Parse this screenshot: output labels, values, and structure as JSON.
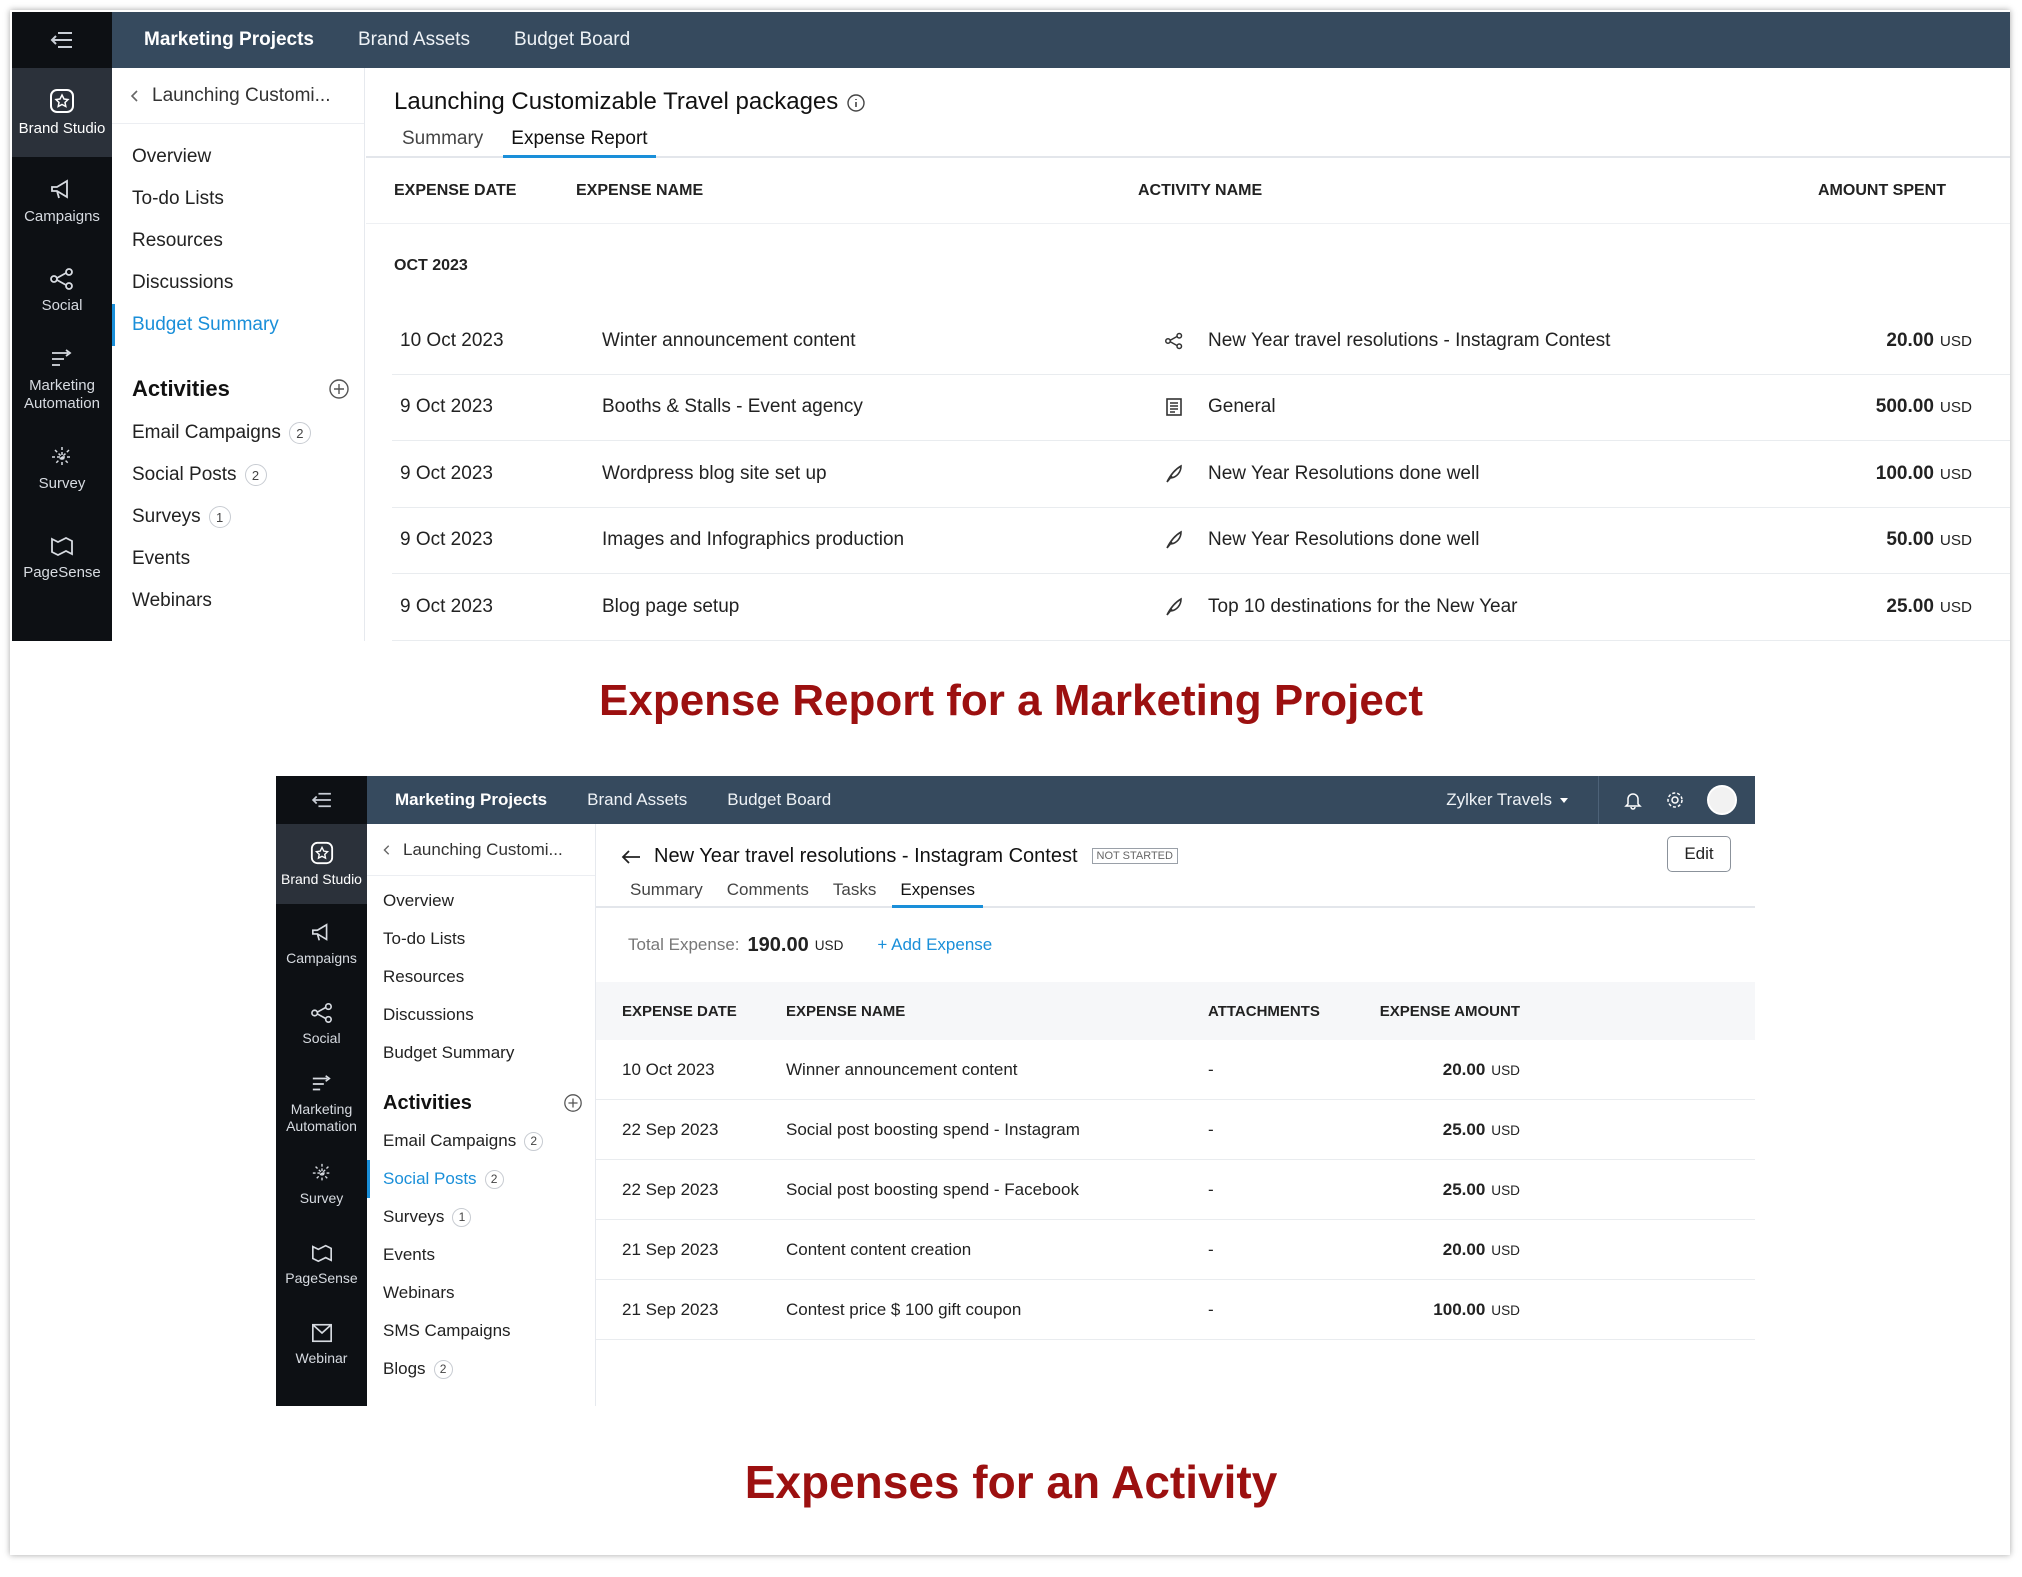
{
  "colors": {
    "rail": "#0d1014",
    "topbar": "#364a5e",
    "accent": "#1a8fd9",
    "caption": "#9c1010"
  },
  "rail": [
    {
      "label": "Brand Studio",
      "icon": "brand-studio-icon"
    },
    {
      "label": "Campaigns",
      "icon": "megaphone-icon"
    },
    {
      "label": "Social",
      "icon": "share-icon"
    },
    {
      "label": "Marketing Automation",
      "icon": "automation-icon"
    },
    {
      "label": "Survey",
      "icon": "survey-icon"
    },
    {
      "label": "PageSense",
      "icon": "pagesense-icon"
    },
    {
      "label": "Webinar",
      "icon": "webinar-icon"
    }
  ],
  "topnav": [
    "Marketing Projects",
    "Brand Assets",
    "Budget Board"
  ],
  "sidebar": {
    "breadcrumb": "Launching Customi...",
    "nav": [
      "Overview",
      "To-do Lists",
      "Resources",
      "Discussions",
      "Budget Summary"
    ],
    "activities_heading": "Activities",
    "activities": [
      {
        "label": "Email Campaigns",
        "count": "2"
      },
      {
        "label": "Social Posts",
        "count": "2"
      },
      {
        "label": "Surveys",
        "count": "1"
      },
      {
        "label": "Events",
        "count": ""
      },
      {
        "label": "Webinars",
        "count": ""
      },
      {
        "label": "SMS Campaigns",
        "count": ""
      },
      {
        "label": "Blogs",
        "count": "2"
      }
    ]
  },
  "report": {
    "title": "Launching Customizable Travel packages",
    "tabs": [
      "Summary",
      "Expense Report"
    ],
    "columns": [
      "EXPENSE DATE",
      "EXPENSE NAME",
      "ACTIVITY NAME",
      "AMOUNT SPENT"
    ],
    "month": "OCT 2023",
    "currency": "USD",
    "rows": [
      {
        "date": "10 Oct 2023",
        "name": "Winter announcement content",
        "activity": "New Year travel resolutions - Instagram Contest",
        "activity_icon": "social-share-icon",
        "amount": "20.00"
      },
      {
        "date": "9 Oct 2023",
        "name": "Booths & Stalls - Event agency",
        "activity": "General",
        "activity_icon": "document-icon",
        "amount": "500.00"
      },
      {
        "date": "9 Oct 2023",
        "name": "Wordpress blog site set up",
        "activity": "New Year Resolutions done well",
        "activity_icon": "quill-icon",
        "amount": "100.00"
      },
      {
        "date": "9 Oct 2023",
        "name": "Images and Infographics production",
        "activity": "New Year Resolutions done well",
        "activity_icon": "quill-icon",
        "amount": "50.00"
      },
      {
        "date": "9 Oct 2023",
        "name": "Blog page setup",
        "activity": "Top 10 destinations for the New Year",
        "activity_icon": "quill-icon",
        "amount": "25.00"
      }
    ]
  },
  "caption_top": "Expense Report for a Marketing Project",
  "activity": {
    "org": "Zylker Travels",
    "title": "New Year travel resolutions - Instagram Contest",
    "status": "NOT STARTED",
    "edit_label": "Edit",
    "tabs": [
      "Summary",
      "Comments",
      "Tasks",
      "Expenses"
    ],
    "total_label": "Total Expense:",
    "total_value": "190.00",
    "currency": "USD",
    "add_label": "+ Add Expense",
    "columns": [
      "EXPENSE DATE",
      "EXPENSE NAME",
      "ATTACHMENTS",
      "EXPENSE AMOUNT"
    ],
    "rows": [
      {
        "date": "10 Oct 2023",
        "name": "Winner announcement content",
        "attachments": "-",
        "amount": "20.00"
      },
      {
        "date": "22 Sep 2023",
        "name": "Social post boosting spend - Instagram",
        "attachments": "-",
        "amount": "25.00"
      },
      {
        "date": "22 Sep 2023",
        "name": "Social post boosting spend - Facebook",
        "attachments": "-",
        "amount": "25.00"
      },
      {
        "date": "21 Sep 2023",
        "name": "Content content creation",
        "attachments": "-",
        "amount": "20.00"
      },
      {
        "date": "21 Sep 2023",
        "name": "Contest price $ 100 gift coupon",
        "attachments": "-",
        "amount": "100.00"
      }
    ]
  },
  "caption_bottom": "Expenses for an Activity"
}
